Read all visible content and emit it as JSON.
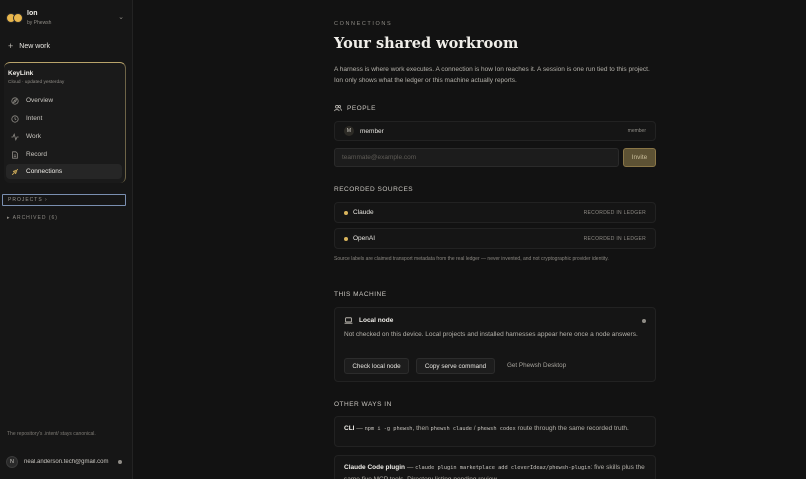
{
  "brand": {
    "name": "Ion",
    "by": "by Phewsh"
  },
  "sidebar": {
    "new_work": "New work",
    "project": {
      "name": "KeyLink",
      "meta": "Cloud · updated yesterday",
      "nav": [
        {
          "label": "Overview",
          "icon": "compass-icon"
        },
        {
          "label": "Intent",
          "icon": "clock-icon"
        },
        {
          "label": "Work",
          "icon": "activity-icon"
        },
        {
          "label": "Record",
          "icon": "document-icon"
        },
        {
          "label": "Connections",
          "icon": "plug-icon",
          "active": true
        }
      ]
    },
    "projects_label": "PROJECTS ›",
    "archived_label": "▸ ARCHIVED (6)",
    "repo_note": "The repository's .intent/ stays canonical.",
    "user": {
      "initial": "N",
      "email": "neal.anderson.tech@gmail.com"
    }
  },
  "main": {
    "eyebrow": "CONNECTIONS",
    "title": "Your shared workroom",
    "intro": "A harness is where work executes. A connection is how Ion reaches it. A session is one run tied to this project. Ion only shows what the ledger or this machine actually reports.",
    "people": {
      "label": "PEOPLE",
      "member": {
        "initial": "M",
        "name": "member",
        "role": "member"
      },
      "invite_placeholder": "teammate@example.com",
      "invite_button": "Invite"
    },
    "sources": {
      "label": "RECORDED SOURCES",
      "items": [
        {
          "name": "Claude",
          "status": "RECORDED IN LEDGER"
        },
        {
          "name": "OpenAI",
          "status": "RECORDED IN LEDGER"
        }
      ],
      "note": "Source labels are claimed transport metadata from the real ledger — never invented, and not cryptographic provider identity."
    },
    "machine": {
      "label": "THIS MACHINE",
      "title": "Local node",
      "desc": "Not checked on this device. Local projects and installed harnesses appear here once a node answers.",
      "check_button": "Check local node",
      "copy_button": "Copy serve command",
      "desktop_link": "Get Phewsh Desktop"
    },
    "other": {
      "label": "OTHER WAYS IN",
      "cli": {
        "name": "CLI",
        "dash": " — ",
        "cmd1": "npm i -g phewsh",
        "t1": ", then ",
        "cmd2": "phewsh claude",
        "t2": " / ",
        "cmd3": "phewsh codex",
        "t3": " route through the same recorded truth."
      },
      "plugin": {
        "name": "Claude Code plugin",
        "dash": " — ",
        "cmd1": "claude plugin marketplace add cleverIdeaz/phewsh-plugin",
        "t1": ": five skills plus the same five MCP tools. Directory listing pending review."
      }
    }
  }
}
